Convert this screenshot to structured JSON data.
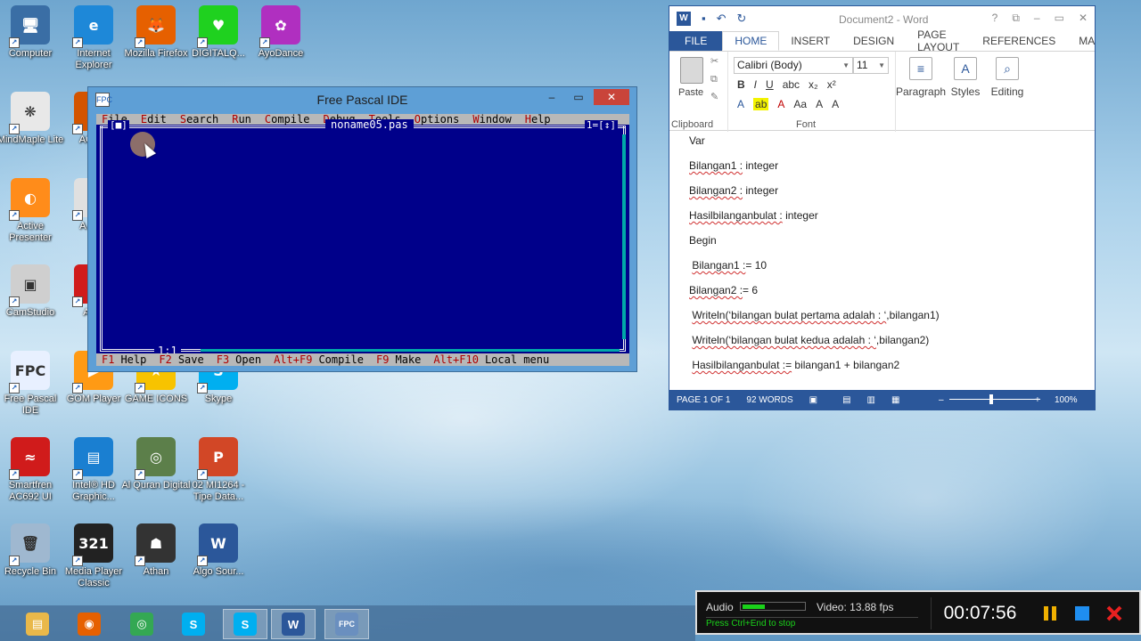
{
  "desktop": {
    "icons": [
      {
        "label": "Computer",
        "glyph": "🖥",
        "color": "#3a6ea5"
      },
      {
        "label": "Internet Explorer",
        "glyph": "e",
        "color": "#1e88d8"
      },
      {
        "label": "Mozilla Firefox",
        "glyph": "🦊",
        "color": "#e66000"
      },
      {
        "label": "DIGITALQ...",
        "glyph": "♥",
        "color": "#1fd11f"
      },
      {
        "label": "AyoDance",
        "glyph": "✿",
        "color": "#b02fc0"
      },
      {
        "label": "MindMaple Lite",
        "glyph": "❋",
        "color": "#e8e8e8"
      },
      {
        "label": "AG Ph",
        "glyph": "",
        "color": "#d35400"
      },
      {
        "label": "Active Presenter",
        "glyph": "◐",
        "color": "#ff8c1a"
      },
      {
        "label": "A Acro",
        "glyph": "",
        "color": "#e0e0e0"
      },
      {
        "label": "CamStudio",
        "glyph": "▣",
        "color": "#cfcfcf"
      },
      {
        "label": "A Re",
        "glyph": "",
        "color": "#d01b1b"
      },
      {
        "label": "Free Pascal IDE",
        "glyph": "FPC",
        "color": "#e8f0ff"
      },
      {
        "label": "GOM Player",
        "glyph": "▶",
        "color": "#ff9a14"
      },
      {
        "label": "GAME ICONS",
        "glyph": "★",
        "color": "#f7c300"
      },
      {
        "label": "Skype",
        "glyph": "S",
        "color": "#00aff0"
      },
      {
        "label": "Smartfren AC692 UI",
        "glyph": "≈",
        "color": "#d01b1b"
      },
      {
        "label": "Intel® HD Graphic...",
        "glyph": "▤",
        "color": "#1a7fd1"
      },
      {
        "label": "Al Quran Digital",
        "glyph": "◎",
        "color": "#5c7f4a"
      },
      {
        "label": "02 MI1264 - Tipe Data...",
        "glyph": "P",
        "color": "#d24726"
      },
      {
        "label": "Recycle Bin",
        "glyph": "🗑",
        "color": "#9fb8d0"
      },
      {
        "label": "Media Player Classic",
        "glyph": "321",
        "color": "#222222"
      },
      {
        "label": "Athan",
        "glyph": "☗",
        "color": "#333333"
      },
      {
        "label": "Algo Sour...",
        "glyph": "W",
        "color": "#2b579a"
      }
    ]
  },
  "fpide": {
    "title": "Free Pascal IDE",
    "app_icon": "FPC",
    "menu": [
      "File",
      "Edit",
      "Search",
      "Run",
      "Compile",
      "Debug",
      "Tools",
      "Options",
      "Window",
      "Help"
    ],
    "editor_filename": "noname05.pas",
    "editor_left_box": "[■]",
    "editor_right_box": "1=[↕]",
    "cursor_pos": "1:1",
    "status_items": [
      {
        "key": "F1",
        "label": "Help"
      },
      {
        "key": "F2",
        "label": "Save"
      },
      {
        "key": "F3",
        "label": "Open"
      },
      {
        "key": "Alt+F9",
        "label": "Compile"
      },
      {
        "key": "F9",
        "label": "Make"
      },
      {
        "key": "Alt+F10",
        "label": "Local menu"
      }
    ],
    "controls": {
      "minimize": "–",
      "maximize": "▭",
      "close": "✕"
    }
  },
  "word": {
    "title": "Document2 - Word",
    "title_controls": {
      "help": "?",
      "ribbon_opts": "⧉",
      "minimize": "–",
      "maximize": "▭",
      "close": "✕"
    },
    "tabs": [
      "FILE",
      "HOME",
      "INSERT",
      "DESIGN",
      "PAGE LAYOUT",
      "REFERENCES",
      "MA"
    ],
    "active_tab": "HOME",
    "ribbon": {
      "paste_label": "Paste",
      "clipboard_label": "Clipboard",
      "font_name": "Calibri (Body)",
      "font_size": "11",
      "font_label": "Font",
      "paragraph_label": "Paragraph",
      "styles_label": "Styles",
      "editing_label": "Editing",
      "fmt_row1": [
        "B",
        "I",
        "U",
        "abc",
        "x₂",
        "x²"
      ],
      "fmt_row2": [
        "A",
        "ab",
        "A",
        "Aa",
        "A",
        "A"
      ]
    },
    "document_lines": [
      {
        "text": "Var",
        "squiggle": ""
      },
      {
        "text": "Bilangan1 : integer",
        "squiggle": "Bilangan1 :"
      },
      {
        "text": "Bilangan2 : integer",
        "squiggle": "Bilangan2 :"
      },
      {
        "text": "Hasilbilanganbulat : integer",
        "squiggle": "Hasilbilanganbulat :"
      },
      {
        "text": "Begin",
        "squiggle": ""
      },
      {
        "text": " Bilangan1 := 10",
        "squiggle": "Bilangan1 :"
      },
      {
        "text": "Bilangan2 := 6",
        "squiggle": "Bilangan2 :"
      },
      {
        "text": " Writeln(‘bilangan bulat pertama adalah : ‘,bilangan1)",
        "squiggle": "Writeln(‘bilangan bulat pertama adalah : ‘"
      },
      {
        "text": " Writeln(‘bilangan bulat kedua adalah : ‘,bilangan2)",
        "squiggle": "Writeln(‘bilangan bulat kedua adalah : ‘"
      },
      {
        "text": " Hasilbilanganbulat := bilangan1 + bilangan2",
        "squiggle": "Hasilbilanganbulat :="
      }
    ],
    "status": {
      "page": "PAGE 1 OF 1",
      "words": "92 WORDS",
      "zoom_minus": "–",
      "zoom_plus": "+",
      "zoom": "100%"
    }
  },
  "recorder": {
    "audio_label": "Audio",
    "audio_level": 0.35,
    "video_label": "Video: 13.88 fps",
    "hint": "Press Ctrl+End to stop",
    "time": "00:07:56",
    "accent": "#1ad21a"
  },
  "taskbar": {
    "items": [
      {
        "name": "file-explorer",
        "glyph": "▤",
        "color": "#e9b84a"
      },
      {
        "name": "firefox",
        "glyph": "◉",
        "color": "#e66000"
      },
      {
        "name": "chrome",
        "glyph": "◎",
        "color": "#34a853"
      },
      {
        "name": "skype",
        "glyph": "S",
        "color": "#00aff0"
      },
      {
        "name": "skype-2",
        "glyph": "S",
        "color": "#00aff0"
      },
      {
        "name": "word",
        "glyph": "W",
        "color": "#2b579a"
      },
      {
        "name": "free-pascal",
        "glyph": "FPC",
        "color": "#6a8fbf"
      }
    ]
  }
}
